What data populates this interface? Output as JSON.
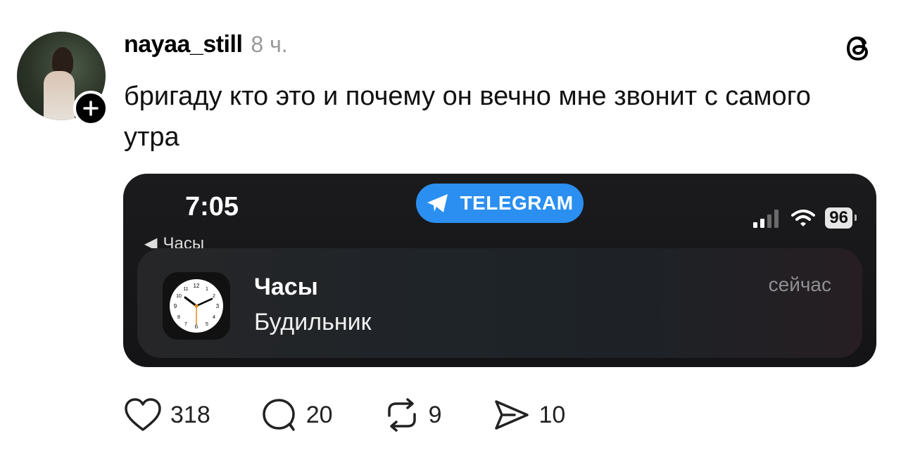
{
  "post": {
    "username": "nayaa_still",
    "time": "8 ч.",
    "text": "бригаду кто это и почему он вечно мне звонит с самого утра"
  },
  "screenshot": {
    "status_time": "7:05",
    "pill_label": "TELEGRAM",
    "battery": "96",
    "back_label": "Часы",
    "notification": {
      "app": "Часы",
      "message": "Будильник",
      "when": "сейчас"
    }
  },
  "actions": {
    "likes": "318",
    "replies": "20",
    "reposts": "9",
    "shares": "10"
  },
  "icons": [
    "plus-icon",
    "threads-logo-icon",
    "telegram-icon",
    "signal-icon",
    "wifi-icon",
    "clock-app-icon",
    "heart-icon",
    "comment-icon",
    "repost-icon",
    "share-icon"
  ],
  "colors": {
    "telegram_blue": "#2a8ff0",
    "card_bg": "#1b1b1d",
    "muted_text": "#999999"
  }
}
